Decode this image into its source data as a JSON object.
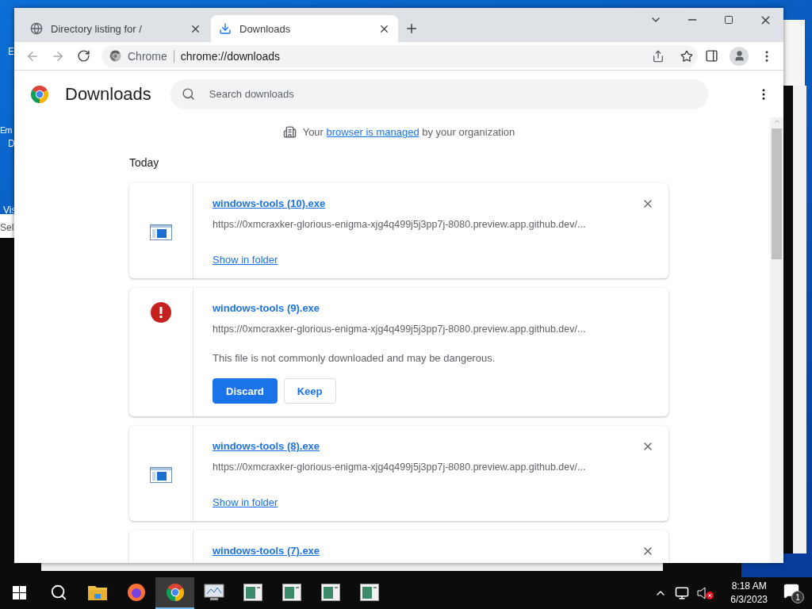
{
  "desktop": {
    "fragments": [
      {
        "text": "E"
      },
      {
        "text": "Em"
      },
      {
        "text": "D"
      },
      {
        "text": "Vis"
      },
      {
        "text": "Sel"
      }
    ]
  },
  "browser": {
    "tabs": [
      {
        "title": "Directory listing for /",
        "selected": false
      },
      {
        "title": "Downloads",
        "selected": true
      }
    ],
    "address": {
      "site_label": "Chrome",
      "url": "chrome://downloads"
    },
    "page": {
      "title": "Downloads",
      "search_placeholder": "Search downloads",
      "managed_notice": {
        "before": "Your",
        "link": "browser is managed",
        "after": "by your organization"
      },
      "section": "Today",
      "downloads": [
        {
          "kind": "complete",
          "name": "windows-tools (10).exe",
          "url": "https://0xmcraxker-glorious-enigma-xjg4q499j5j3pp7j-8080.preview.app.github.dev/...",
          "action": "Show in folder"
        },
        {
          "kind": "dangerous",
          "name": "windows-tools (9).exe",
          "url": "https://0xmcraxker-glorious-enigma-xjg4q499j5j3pp7j-8080.preview.app.github.dev/...",
          "warning": "This file is not commonly downloaded and may be dangerous.",
          "buttons": [
            {
              "label": "Discard",
              "kind": "primary"
            },
            {
              "label": "Keep",
              "kind": "secondary"
            }
          ]
        },
        {
          "kind": "complete",
          "name": "windows-tools (8).exe",
          "url": "https://0xmcraxker-glorious-enigma-xjg4q499j5j3pp7j-8080.preview.app.github.dev/...",
          "action": "Show in folder"
        },
        {
          "kind": "complete",
          "name": "windows-tools (7).exe"
        }
      ]
    }
  },
  "taskbar": {
    "apps": [
      {
        "kind": "start",
        "active": false
      },
      {
        "kind": "search",
        "active": false
      },
      {
        "kind": "folder",
        "active": false
      },
      {
        "kind": "firefox",
        "active": false
      },
      {
        "kind": "chrome",
        "active": true
      },
      {
        "kind": "monitor",
        "active": false
      },
      {
        "kind": "window",
        "active": false
      },
      {
        "kind": "window",
        "active": false
      },
      {
        "kind": "window",
        "active": false
      },
      {
        "kind": "window",
        "active": false
      }
    ],
    "time": "8:18 AM",
    "date": "6/3/2023",
    "notification_count": "1"
  }
}
